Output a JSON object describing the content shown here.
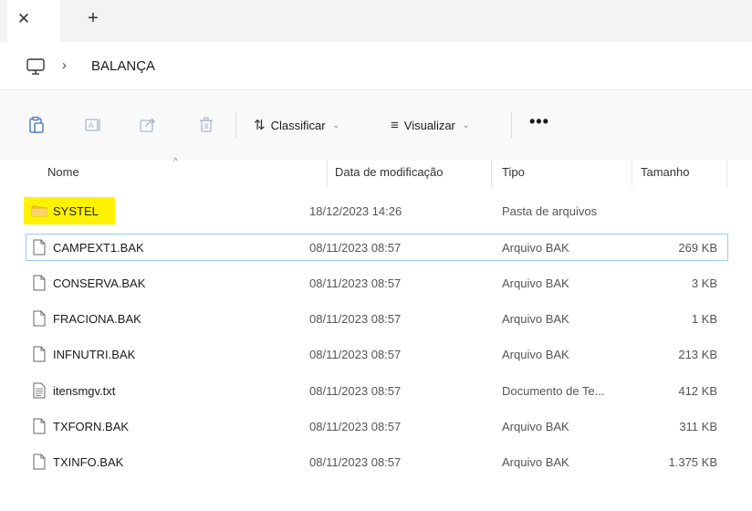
{
  "tabs": {
    "close_glyph": "✕",
    "new_glyph": "+"
  },
  "address": {
    "separator": "›",
    "folder": "BALANÇA",
    "icon": "this-pc-icon"
  },
  "toolbar": {
    "icons": [
      "paste-icon",
      "rename-icon",
      "share-icon",
      "delete-icon"
    ],
    "sort_label": "Classificar",
    "view_label": "Visualizar",
    "more_label": "•••"
  },
  "columns": {
    "name": "Nome",
    "date": "Data de modificação",
    "type": "Tipo",
    "size": "Tamanho"
  },
  "files": [
    {
      "name": "SYSTEL",
      "date": "18/12/2023 14:26",
      "type": "Pasta de arquivos",
      "size": "",
      "icon": "folder-icon"
    },
    {
      "name": "CAMPEXT1.BAK",
      "date": "08/11/2023 08:57",
      "type": "Arquivo BAK",
      "size": "269 KB",
      "icon": "file-icon"
    },
    {
      "name": "CONSERVA.BAK",
      "date": "08/11/2023 08:57",
      "type": "Arquivo BAK",
      "size": "3 KB",
      "icon": "file-icon"
    },
    {
      "name": "FRACIONA.BAK",
      "date": "08/11/2023 08:57",
      "type": "Arquivo BAK",
      "size": "1 KB",
      "icon": "file-icon"
    },
    {
      "name": "INFNUTRI.BAK",
      "date": "08/11/2023 08:57",
      "type": "Arquivo BAK",
      "size": "213 KB",
      "icon": "file-icon"
    },
    {
      "name": "itensmgv.txt",
      "date": "08/11/2023 08:57",
      "type": "Documento de Te...",
      "size": "412 KB",
      "icon": "text-file-icon"
    },
    {
      "name": "TXFORN.BAK",
      "date": "08/11/2023 08:57",
      "type": "Arquivo BAK",
      "size": "311 KB",
      "icon": "file-icon"
    },
    {
      "name": "TXINFO.BAK",
      "date": "08/11/2023 08:57",
      "type": "Arquivo BAK",
      "size": "1.375 KB",
      "icon": "file-icon"
    }
  ],
  "colors": {
    "highlight": "#fff200",
    "folder": "#f4c542",
    "selection_border": "#99c9f0"
  }
}
